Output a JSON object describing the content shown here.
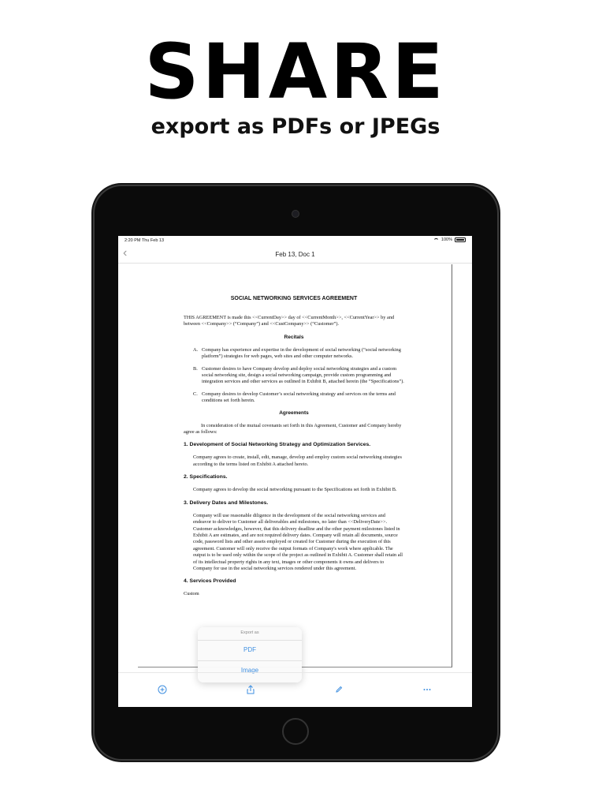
{
  "promo": {
    "headline": "SHARE",
    "subheadline": "export as PDFs or JPEGs"
  },
  "status_bar": {
    "time": "2:20 PM  Thu Feb 13",
    "battery": "100%"
  },
  "nav": {
    "title": "Feb 13, Doc 1"
  },
  "document": {
    "title": "SOCIAL NETWORKING SERVICES AGREEMENT",
    "intro": "THIS AGREEMENT is made this <<CurrentDay>> day of <<CurrentMonth>>, <<CurrentYear>> by and between <<Company>> (“Company”) and <<CustCompany>> (“Customer”).",
    "recitals_heading": "Recitals",
    "recitals": [
      {
        "label": "A.",
        "text": "Company has experience and expertise in the development of social networking (“social networking platform”) strategies for web pages, web sites and other computer networks."
      },
      {
        "label": "B.",
        "text": "Customer desires to have Company develop and deploy social networking strategies and a custom social networking site, design a social networking campaign, provide custom programming and integration services and other services as outlined in Exhibit B, attached herein (the “Specifications”)."
      },
      {
        "label": "C.",
        "text": "Company desires to develop Customer’s social networking strategy and services on the terms and conditions set forth herein."
      }
    ],
    "agreements_heading": "Agreements",
    "agreements_intro": "In consideration of the mutual covenants set forth in this Agreement, Customer and Company hereby agree as follows:",
    "sections": [
      {
        "heading": "1. Development of Social Networking Strategy and Optimization Services.",
        "text": "Company agrees to create, install, edit, manage, develop and employ custom social networking strategies according to the terms listed on Exhibit A attached hereto."
      },
      {
        "heading": "2. Specifications.",
        "text": "Company agrees to develop the social networking pursuant to the Specifications set forth in Exhibit B."
      },
      {
        "heading": "3. Delivery Dates and Milestones.",
        "text": "Company will use reasonable diligence in the development of the social networking services and endeavor to deliver to Customer all deliverables and milestones, no later than <<DeliveryDate>>. Customer acknowledges, however, that this delivery deadline and the other payment milestones listed in Exhibit A are estimates, and are not required delivery dates. Company will retain all documents, source code, password lists and other assets employed or created for Customer during the execution of this agreement. Customer will only receive the output formats of Company's work where applicable. The output is to be used only within the scope of the project as outlined in Exhibit A. Customer shall retain all of its intellectual property rights in any text, images or other components it owns and delivers to Company for use in the social networking services rendered under this agreement."
      },
      {
        "heading": "4. Services Provided",
        "text": "Custom"
      }
    ]
  },
  "export_popover": {
    "title": "Export as",
    "options": [
      "PDF",
      "Image"
    ],
    "accent_color": "#3f8fe0"
  },
  "toolbar": {
    "icons": [
      "add-icon",
      "share-icon",
      "pencil-icon",
      "more-icon"
    ]
  }
}
